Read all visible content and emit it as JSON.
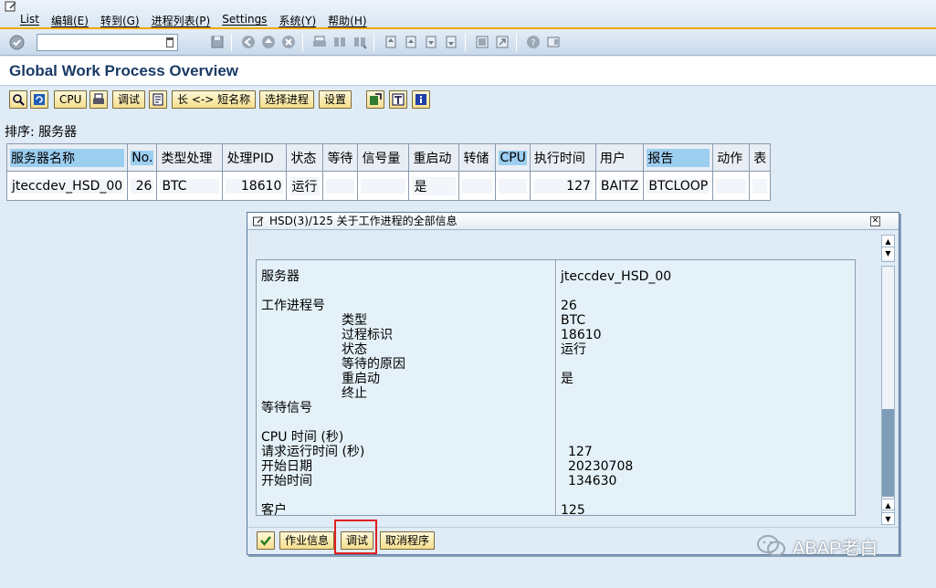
{
  "menu": {
    "items": [
      "List",
      "编辑(E)",
      "转到(G)",
      "进程列表(P)",
      "Settings",
      "系统(Y)",
      "帮助(H)"
    ]
  },
  "std_toolbar": {
    "command_value": "",
    "icons": [
      "ok-icon",
      "save-icon",
      "back-icon",
      "exit-icon",
      "cancel-icon",
      "print-icon",
      "find-icon",
      "find-next-icon",
      "first-page-icon",
      "prev-page-icon",
      "next-page-icon",
      "last-page-icon",
      "create-session-icon",
      "shortcut-icon",
      "help-icon",
      "layout-icon"
    ]
  },
  "title": "Global Work Process Overview",
  "app_toolbar": {
    "cpu": "CPU",
    "debug": "调试",
    "long_short": "长 <-> 短名称",
    "select_process": "选择进程",
    "settings": "设置"
  },
  "sort_label": "排序: 服务器",
  "grid": {
    "headers": [
      "服务器名称",
      "No.",
      "类型处理",
      "处理PID",
      "状态",
      "等待",
      "信号量",
      "重启动",
      "转储",
      "CPU",
      "执行时间",
      "用户",
      "报告",
      "动作",
      "表"
    ],
    "rows": [
      [
        "jteccdev_HSD_00",
        "26",
        "BTC",
        "18610",
        "运行",
        "",
        "",
        "是",
        "",
        "",
        "127",
        "BAITZ",
        "BTCLOOP",
        "",
        ""
      ]
    ]
  },
  "popup": {
    "title": "HSD(3)/125 关于工作进程的全部信息",
    "labels": {
      "server": "服务器",
      "wp_no": "工作进程号",
      "type": "类型",
      "pid": "过程标识",
      "status": "状态",
      "wait_reason": "等待的原因",
      "restart": "重启动",
      "terminate": "终止",
      "wait_semaphore": "等待信号",
      "cpu_time": "CPU 时间 (秒)",
      "req_run_time": "请求运行时间 (秒)",
      "start_date": "开始日期",
      "start_time": "开始时间",
      "client": "客户"
    },
    "values": {
      "server": "jteccdev_HSD_00",
      "wp_no": "26",
      "type": "BTC",
      "pid": "18610",
      "status": "运行",
      "restart": "是",
      "req_run_time": "127",
      "start_date": "20230708",
      "start_time": "134630",
      "client": "125"
    },
    "buttons": {
      "job_info": "作业信息",
      "debug": "调试",
      "cancel_program": "取消程序"
    }
  },
  "watermark": "ABAP老白"
}
